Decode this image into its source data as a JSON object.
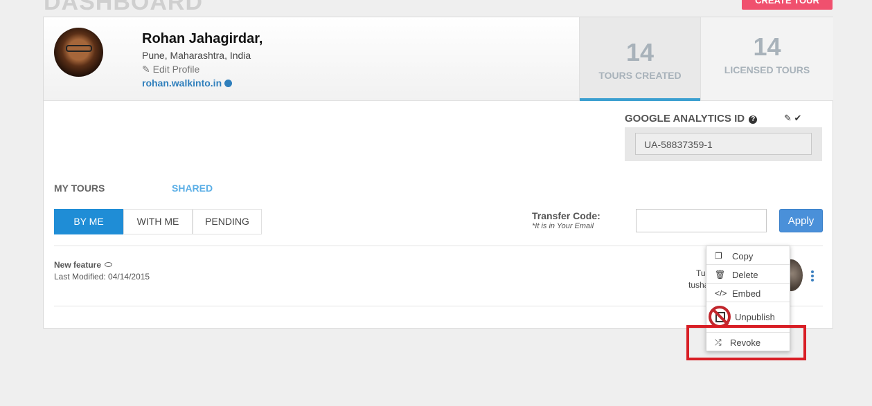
{
  "header": {
    "page_title": "DASHBOARD",
    "create_button": "CREATE TOUR"
  },
  "profile": {
    "name": "Rohan Jahagirdar,",
    "location": "Pune, Maharashtra, India",
    "edit_label": "Edit Profile",
    "website": "rohan.walkinto.in"
  },
  "stats": [
    {
      "value": "14",
      "label": "TOURS CREATED",
      "active": true
    },
    {
      "value": "14",
      "label": "LICENSED TOURS",
      "active": false
    }
  ],
  "analytics": {
    "label": "GOOGLE ANALYTICS ID",
    "value": "UA-58837359-1"
  },
  "tour_tabs": {
    "my_tours": "MY TOURS",
    "shared": "SHARED"
  },
  "filters": [
    {
      "label": "BY ME",
      "active": true
    },
    {
      "label": "WITH ME",
      "active": false
    },
    {
      "label": "PENDING",
      "active": false
    }
  ],
  "transfer": {
    "label": "Transfer Code:",
    "note": "*It is in Your Email",
    "apply_label": "Apply"
  },
  "tour": {
    "name": "New feature",
    "modified": "Last Modified: 04/14/2015",
    "owner_line1": "Tus",
    "owner_line2": "tusha"
  },
  "context_menu": [
    {
      "label": "Copy",
      "icon": "copy-icon"
    },
    {
      "label": "Delete",
      "icon": "trash-icon"
    },
    {
      "label": "Embed",
      "icon": "code-icon"
    },
    {
      "label": "Unpublish",
      "icon": "unpublish-icon"
    },
    {
      "label": "Revoke",
      "icon": "shuffle-icon"
    }
  ],
  "colors": {
    "accent": "#1f8dd6",
    "highlight": "#d81e25",
    "create_button": "#f0506e"
  }
}
